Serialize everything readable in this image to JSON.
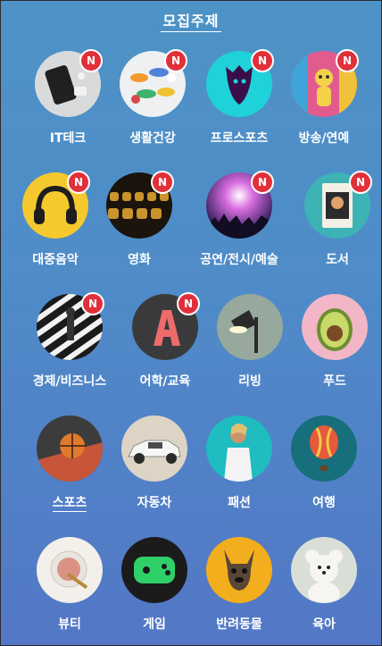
{
  "title": "모집주제",
  "badge_text": "N",
  "items": [
    {
      "label": "IT테크",
      "icon": "phone-icon",
      "new": true
    },
    {
      "label": "생활건강",
      "icon": "pills-icon",
      "new": true
    },
    {
      "label": "프로스포츠",
      "icon": "lion-crest-icon",
      "new": true
    },
    {
      "label": "방송/연예",
      "icon": "figure-icon",
      "new": true
    },
    {
      "label": "대중음악",
      "icon": "headphones-icon",
      "new": true
    },
    {
      "label": "영화",
      "icon": "cinema-seats-icon",
      "new": true
    },
    {
      "label": "공연/전시/예술",
      "icon": "concert-icon",
      "new": true
    },
    {
      "label": "도서",
      "icon": "book-icon",
      "new": true
    },
    {
      "label": "경제/비즈니스",
      "icon": "crosswalk-icon",
      "new": true
    },
    {
      "label": "어학/교육",
      "icon": "letter-a-icon",
      "new": true
    },
    {
      "label": "리빙",
      "icon": "lamp-icon",
      "new": false
    },
    {
      "label": "푸드",
      "icon": "avocado-icon",
      "new": false
    },
    {
      "label": "스포츠",
      "icon": "basketball-icon",
      "new": false
    },
    {
      "label": "자동차",
      "icon": "car-icon",
      "new": false
    },
    {
      "label": "패션",
      "icon": "fashion-model-icon",
      "new": false
    },
    {
      "label": "여행",
      "icon": "hot-air-balloon-icon",
      "new": false
    },
    {
      "label": "뷰티",
      "icon": "cosmetics-icon",
      "new": false
    },
    {
      "label": "게임",
      "icon": "game-controller-icon",
      "new": false
    },
    {
      "label": "반려동물",
      "icon": "dog-icon",
      "new": false
    },
    {
      "label": "육아",
      "icon": "teddy-bear-icon",
      "new": false
    }
  ]
}
